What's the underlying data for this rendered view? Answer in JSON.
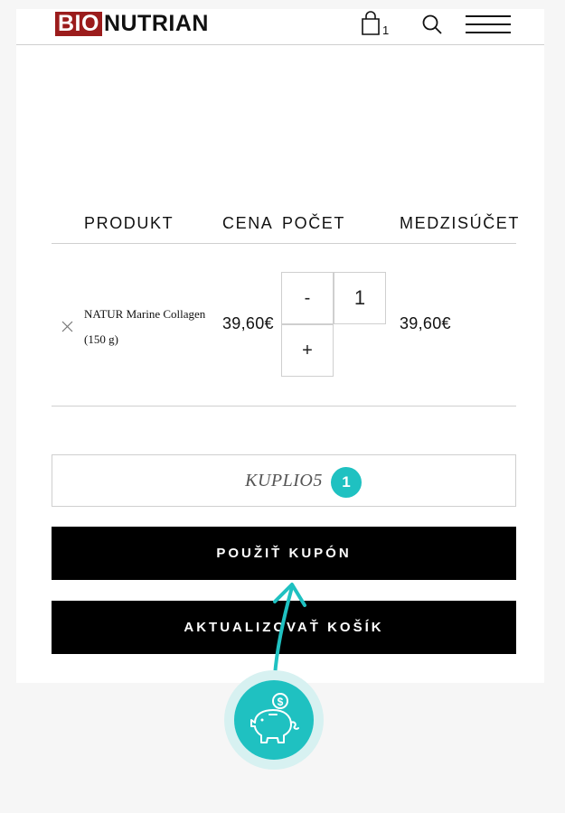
{
  "header": {
    "logo_part1": "BIO",
    "logo_part2": "NUTRIAN",
    "cart_count": "1",
    "icons": [
      "cart-icon",
      "search-icon",
      "menu-icon"
    ],
    "brand_color": "#9b1c1c"
  },
  "cart_table": {
    "columns": [
      "PRODUKT",
      "CENA",
      "POČET",
      "MEDZISÚČET"
    ],
    "rows": [
      {
        "product": "NATUR Marine Collagen (150 g)",
        "price": "39,60€",
        "quantity": "1",
        "minus_label": "-",
        "plus_label": "+",
        "subtotal": "39,60€"
      }
    ]
  },
  "coupon": {
    "value": "KUPLIO5",
    "badge": "1"
  },
  "buttons": {
    "apply_coupon": "POUŽIŤ KUPÓN",
    "update_cart": "AKTUALIZOVAŤ KOŠÍK"
  },
  "accent_color": "#1fc1c1"
}
